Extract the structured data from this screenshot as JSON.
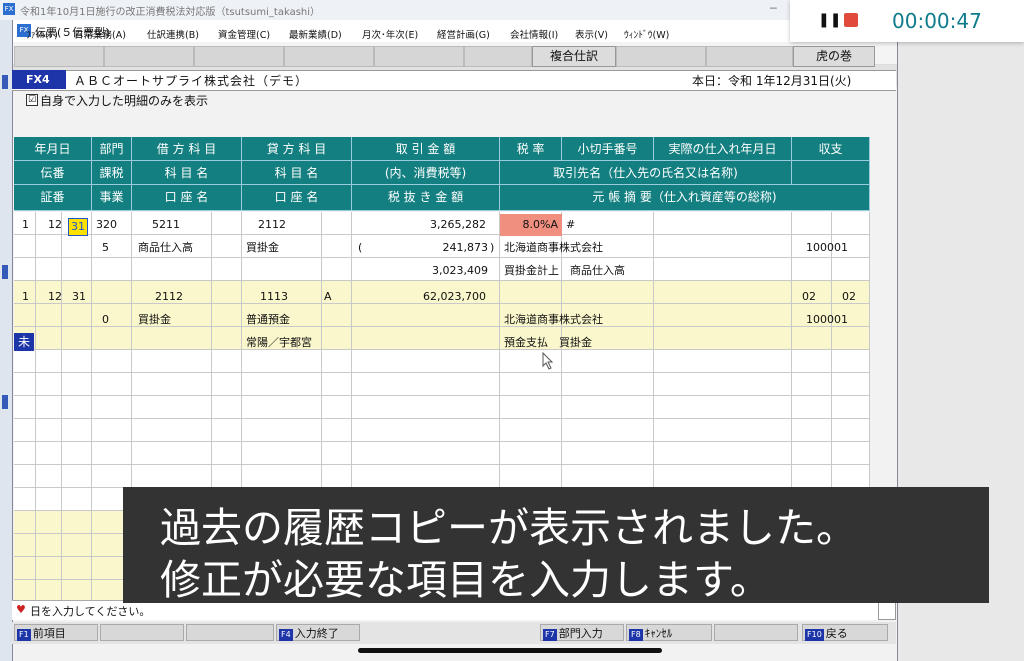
{
  "bg_window": {
    "title": "令和1年10月1日施行の改正消費税法対応版（tsutsumi_takashi）",
    "icon": "FX",
    "minimize": "─"
  },
  "window": {
    "title": "伝票(５伝票型)",
    "icon": "FX"
  },
  "menu": [
    "ﾌｧｲﾙ(F)",
    "日常業務(A)",
    "仕訳連携(B)",
    "資金管理(C)",
    "最新業績(D)",
    "月次･年次(E)",
    "経営計画(G)",
    "会社情報(I)",
    "表示(V)",
    "ｳｨﾝﾄﾞｳ(W)"
  ],
  "toolbar": {
    "fukugo": "複合仕訳",
    "tora": "虎の巻"
  },
  "company": {
    "badge": "FX4",
    "name": "ＡＢＣオートサプライ株式会社（デモ）",
    "today": "本日：令和 1年12月31日(火)"
  },
  "filter": {
    "check": "☑",
    "label": "自身で入力した明細のみを表示"
  },
  "headers": {
    "r1": [
      "年月日",
      "部門",
      "借 方 科 目",
      "貸 方 科 目",
      "取 引 金 額",
      "税 率",
      "小切手番号",
      "実際の仕入れ年月日",
      "収支"
    ],
    "r2": [
      "伝番",
      "課税",
      "科 目 名",
      "科 目 名",
      "(内、消費税等)",
      "取引先名（仕入先の氏名又は名称)"
    ],
    "r3": [
      "証番",
      "事業",
      "口 座 名",
      "口 座 名",
      "税 抜 き 金 額",
      "元 帳 摘 要（仕入れ資産等の総称)"
    ]
  },
  "entry1": {
    "month_idx": "1",
    "month": "12",
    "day": "31",
    "dept": "320",
    "debit_code": "5211",
    "credit_code": "2112",
    "amount": "3,265,282",
    "tax_rate": "8.0%A",
    "check": "#",
    "tax_kbn": "5",
    "debit_name": "商品仕入高",
    "credit_name": "買掛金",
    "tax_open": "(",
    "tax_amount": "241,873",
    "tax_close": ")",
    "partner": "北海道商事株式会社",
    "partner_code": "100001",
    "net_amount": "3,023,409",
    "memo": "買掛金計上　商品仕入高"
  },
  "entry2": {
    "month_idx": "1",
    "month": "12",
    "day": "31",
    "debit_code": "2112",
    "credit_code": "1113",
    "credit_sub": "A",
    "amount": "62,023,700",
    "io1": "02",
    "io2": "02",
    "tax_kbn": "0",
    "debit_name": "買掛金",
    "credit_name": "普通預金",
    "partner": "北海道商事株式会社",
    "partner_code": "100001",
    "mark": "未",
    "credit_account": "常陽／宇都宮",
    "memo": "預金支払　買掛金"
  },
  "status": {
    "heart": "♥",
    "text": "日を入力してください。"
  },
  "fkeys": [
    {
      "key": "F1",
      "label": "前項目"
    },
    {
      "key": "F4",
      "label": "入力終了"
    },
    {
      "key": "F7",
      "label": "部門入力"
    },
    {
      "key": "F8",
      "label": "ｷｬﾝｾﾙ"
    },
    {
      "key": "F10",
      "label": "戻る"
    }
  ],
  "recorder": {
    "time": "00:00:47",
    "pause": "❚❚"
  },
  "subtitle": {
    "line1": "過去の履歴コピーが表示されました。",
    "line2": "修正が必要な項目を入力します。"
  }
}
